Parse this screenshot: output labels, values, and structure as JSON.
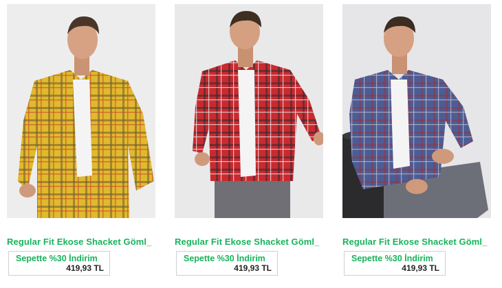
{
  "products": [
    {
      "name": "Regular Fit Ekose Shacket Göml_",
      "promo": "Sepette %30 İndirim",
      "price": "419,93 TL",
      "image_desc": "man-in-yellow-plaid-shirt",
      "colors": {
        "shirt": "#e1b92e",
        "stripe": "#6d5a2e",
        "stripe2": "#c9542a"
      }
    },
    {
      "name": "Regular Fit Ekose Shacket Göml_",
      "promo": "Sepette %30 İndirim",
      "price": "419,93 TL",
      "image_desc": "man-in-red-plaid-shirt",
      "colors": {
        "shirt": "#c92a30",
        "stripe": "#3a2b33",
        "stripe2": "#e8e2dc"
      }
    },
    {
      "name": "Regular Fit Ekose Shacket Göml_",
      "promo": "Sepette %30 İndirim",
      "price": "419,93 TL",
      "image_desc": "man-in-blue-plaid-shirt-seated",
      "colors": {
        "shirt": "#4c5d96",
        "stripe": "#8a3b4c",
        "stripe2": "#c9c4cf"
      }
    }
  ]
}
